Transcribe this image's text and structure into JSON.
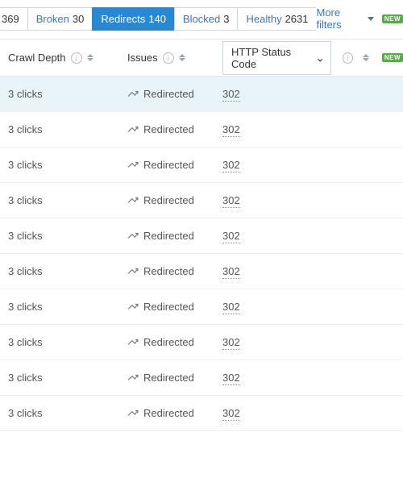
{
  "tabs": {
    "all_partial": "369",
    "broken_label": "Broken",
    "broken_count": "30",
    "redirects_label": "Redirects",
    "redirects_count": "140",
    "blocked_label": "Blocked",
    "blocked_count": "3",
    "healthy_label": "Healthy",
    "healthy_count": "2631"
  },
  "more_filters_label": "More filters",
  "new_badge": "NEW",
  "headers": {
    "crawl_depth": "Crawl Depth",
    "issues": "Issues",
    "status_dropdown": "HTTP Status Code"
  },
  "rows": [
    {
      "depth": "3 clicks",
      "issue": "Redirected",
      "status": "302",
      "highlight": true
    },
    {
      "depth": "3 clicks",
      "issue": "Redirected",
      "status": "302",
      "highlight": false
    },
    {
      "depth": "3 clicks",
      "issue": "Redirected",
      "status": "302",
      "highlight": false
    },
    {
      "depth": "3 clicks",
      "issue": "Redirected",
      "status": "302",
      "highlight": false
    },
    {
      "depth": "3 clicks",
      "issue": "Redirected",
      "status": "302",
      "highlight": false
    },
    {
      "depth": "3 clicks",
      "issue": "Redirected",
      "status": "302",
      "highlight": false
    },
    {
      "depth": "3 clicks",
      "issue": "Redirected",
      "status": "302",
      "highlight": false
    },
    {
      "depth": "3 clicks",
      "issue": "Redirected",
      "status": "302",
      "highlight": false
    },
    {
      "depth": "3 clicks",
      "issue": "Redirected",
      "status": "302",
      "highlight": false
    },
    {
      "depth": "3 clicks",
      "issue": "Redirected",
      "status": "302",
      "highlight": false
    }
  ]
}
